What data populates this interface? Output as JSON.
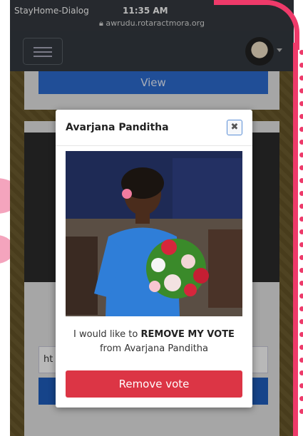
{
  "status_bar": {
    "carrier": "StayHome-Dialog",
    "time": "11:35 AM",
    "url": "awrudu.rotaractmora.org"
  },
  "navbar": {
    "menu_icon": "hamburger-icon",
    "avatar_icon": "anonymous-mask-avatar"
  },
  "background": {
    "view_button_label": "View",
    "input_value": "ht"
  },
  "modal": {
    "title": "Avarjana Panditha",
    "close_icon": "close-icon",
    "close_glyph": "✖",
    "photo": "person-holding-flower-bouquet",
    "message_prefix": "I would like to",
    "message_strong": "REMOVE MY VOTE",
    "message_suffix": "from Avarjana Panditha",
    "remove_button_label": "Remove vote"
  },
  "colors": {
    "accent_pink": "#ee3a6a",
    "primary_blue": "#2d6cd1",
    "danger_red": "#dc3545",
    "navbar": "#343a40"
  }
}
